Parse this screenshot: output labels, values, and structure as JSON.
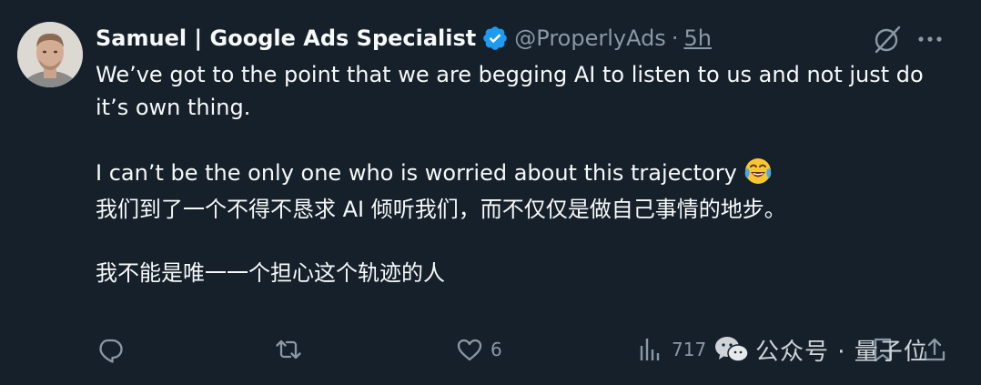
{
  "tweet": {
    "author_name": "Samuel | Google Ads Specialist",
    "handle": "@ProperlyAds",
    "separator": "·",
    "time": "5h",
    "body_line1": "We’ve got to the point that we are begging AI to listen to us and not just do it’s own thing.",
    "body_line2": "I can’t be the only one who is worried about this trajectory",
    "body_line3": "我们到了一个不得不恳求 AI 倾听我们，而不仅仅是做自己事情的地步。",
    "body_line4": "我不能是唯一一个担心这个轨迹的人"
  },
  "actions": {
    "reply_count": "",
    "retweet_count": "",
    "like_count": "6",
    "views_count": "717"
  },
  "watermark": {
    "text": "公众号 · 量子位"
  },
  "colors": {
    "background": "#15202b",
    "text": "#f7f9f9",
    "muted": "#8b98a5",
    "verified": "#1d9bf0"
  },
  "icons": [
    "verified-badge-icon",
    "grok-icon",
    "more-icon",
    "reply-icon",
    "retweet-icon",
    "like-icon",
    "views-icon",
    "wechat-icon"
  ]
}
